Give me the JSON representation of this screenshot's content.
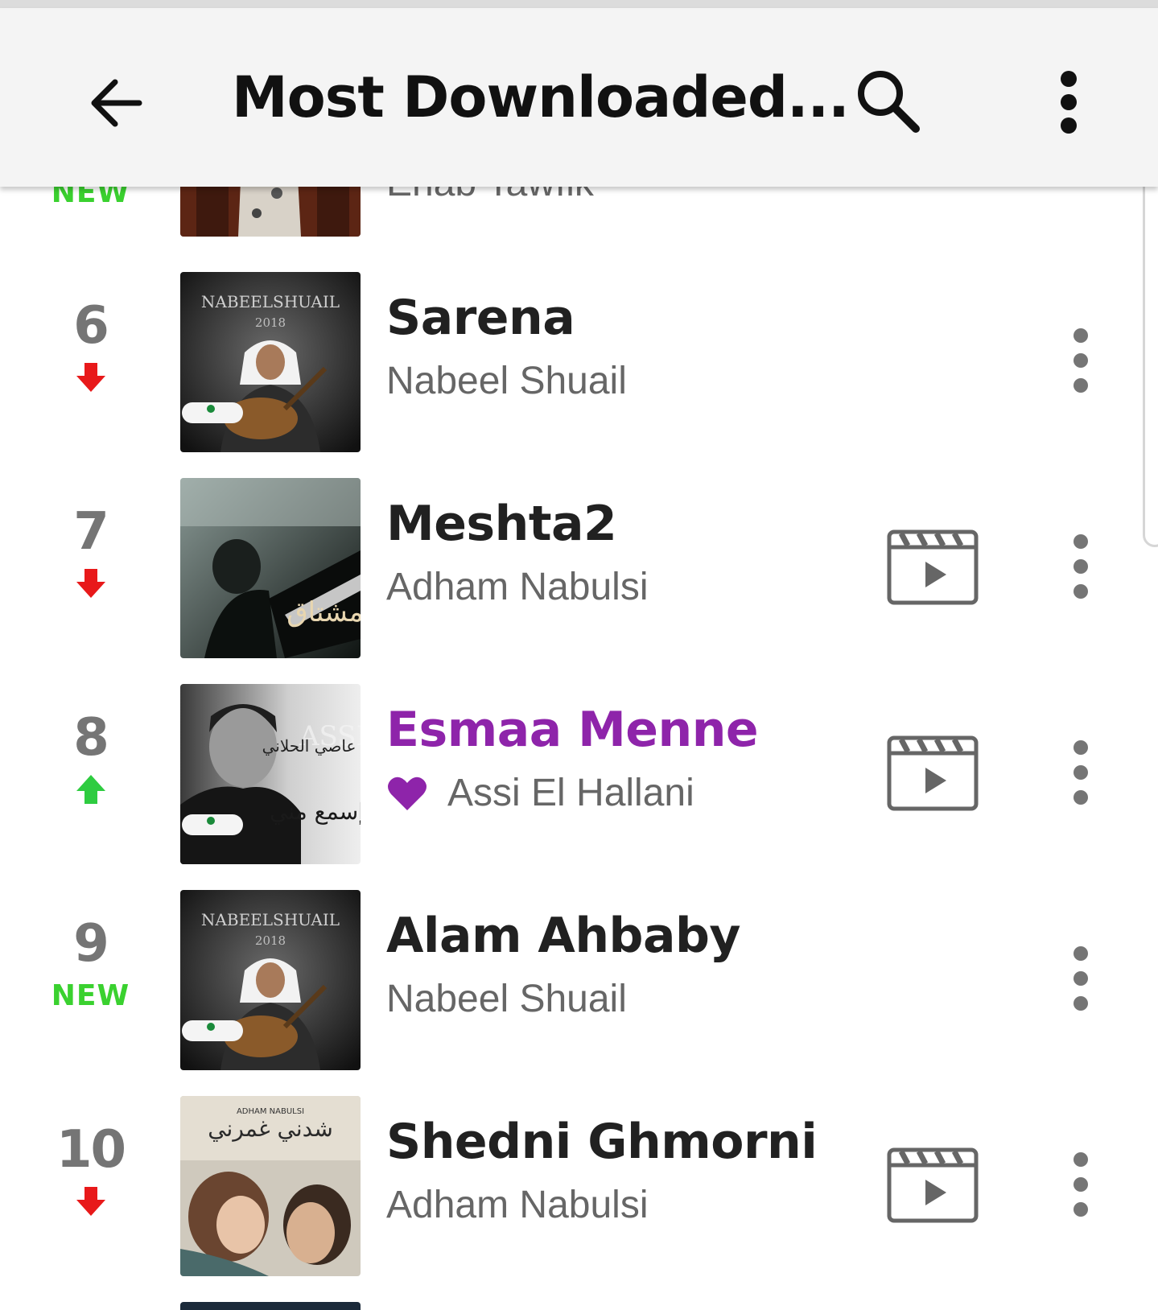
{
  "app_bar": {
    "title": "Most Downloaded...",
    "back_icon": "arrow-left-icon",
    "search_icon": "search-icon",
    "menu_icon": "more-vert-icon"
  },
  "colors": {
    "accent_purple": "#8e24aa",
    "rank_up": "#2ecc40",
    "rank_down": "#e8191a",
    "new_label": "#3ad12f"
  },
  "partial_top_row": {
    "change_label": "NEW",
    "artist": "Ehab Tawfik"
  },
  "songs": [
    {
      "rank": "6",
      "change": "down",
      "title": "Sarena",
      "artist": "Nabeel Shuail",
      "has_video": false,
      "favorite": false
    },
    {
      "rank": "7",
      "change": "down",
      "title": "Meshta2",
      "artist": "Adham Nabulsi",
      "has_video": true,
      "favorite": false
    },
    {
      "rank": "8",
      "change": "up",
      "title": "Esmaa Menne",
      "artist": "Assi El Hallani",
      "has_video": true,
      "favorite": true
    },
    {
      "rank": "9",
      "change": "new",
      "change_label": "NEW",
      "title": "Alam Ahbaby",
      "artist": "Nabeel Shuail",
      "has_video": false,
      "favorite": false
    },
    {
      "rank": "10",
      "change": "down",
      "title": "Shedni Ghmorni",
      "artist": "Adham Nabulsi",
      "has_video": true,
      "favorite": false
    }
  ],
  "album_art_text": {
    "nabeel_cover_top": "NABEELSHUAIL",
    "nabeel_cover_year": "2018",
    "meshta2_cover": "مشتاق",
    "assi_cover_name": "ASSI",
    "assi_cover_arabic": "عاصي الحلاني",
    "assi_cover_song": "إسمع مني",
    "shedni_cover_artist": "ADHAM NABULSI",
    "shedni_cover_song": "شدني غمرني"
  }
}
